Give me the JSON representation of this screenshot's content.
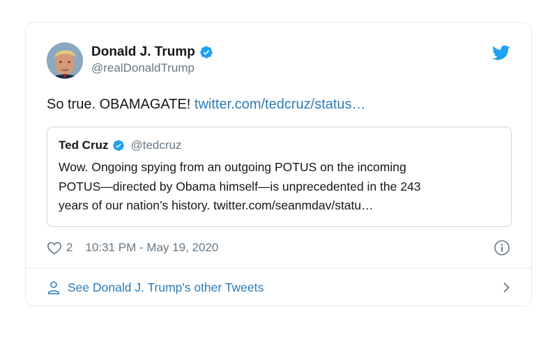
{
  "author": {
    "name": "Donald J. Trump",
    "handle": "@realDonaldTrump",
    "avatar_icon": "profile-photo"
  },
  "tweet": {
    "text": "So true. OBAMAGATE! ",
    "link": "twitter.com/tedcruz/status…"
  },
  "quoted": {
    "name": "Ted Cruz",
    "handle": "@tedcruz",
    "lines": [
      "Wow.  Ongoing spying from an outgoing POTUS on the incoming",
      "POTUS—directed by Obama himself—is unprecedented in the 243",
      "years of our nation’s history. twitter.com/seanmdav/statu…"
    ]
  },
  "meta": {
    "likes": "2",
    "timestamp": "10:31 PM - May 19, 2020"
  },
  "footer": {
    "label": "See Donald J. Trump's other Tweets"
  },
  "colors": {
    "link": "#2b7bb9",
    "verified": "#1da1f2",
    "twitter_bird": "#1da1f2",
    "muted": "#657786",
    "border": "#e1e8ed"
  }
}
